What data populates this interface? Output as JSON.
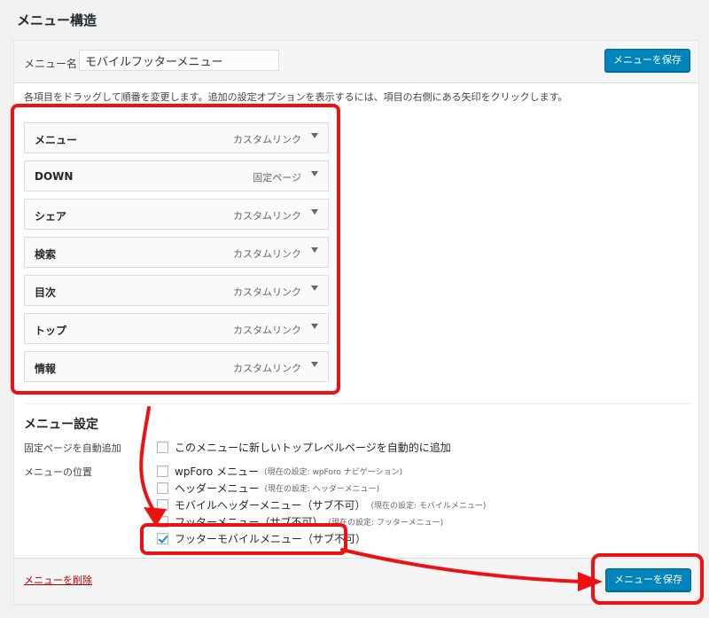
{
  "page_title": "メニュー構造",
  "menu_name": {
    "label": "メニュー名",
    "value": "モバイルフッターメニュー"
  },
  "save_button_label": "メニューを保存",
  "instructions": "各項目をドラッグして順番を変更します。追加の設定オプションを表示するには、項目の右側にある矢印をクリックします。",
  "menu_items": [
    {
      "title": "メニュー",
      "type": "カスタムリンク"
    },
    {
      "title": "DOWN",
      "type": "固定ページ"
    },
    {
      "title": "シェア",
      "type": "カスタムリンク"
    },
    {
      "title": "検索",
      "type": "カスタムリンク"
    },
    {
      "title": "目次",
      "type": "カスタムリンク"
    },
    {
      "title": "トップ",
      "type": "カスタムリンク"
    },
    {
      "title": "情報",
      "type": "カスタムリンク"
    }
  ],
  "settings": {
    "title": "メニュー設定",
    "auto_add": {
      "label": "固定ページを自動追加",
      "option": "このメニューに新しいトップレベルページを自動的に追加",
      "checked": false
    },
    "locations_label": "メニューの位置",
    "locations": [
      {
        "label": "wpForo メニュー",
        "note": "(現在の設定: wpForo ナビゲーション)",
        "checked": false
      },
      {
        "label": "ヘッダーメニュー",
        "note": "(現在の設定: ヘッダーメニュー)",
        "checked": false
      },
      {
        "label": "モバイルヘッダーメニュー（サブ不可）",
        "note": "(現在の設定: モバイルメニュー)",
        "checked": false
      },
      {
        "label": "フッターメニュー（サブ不可）",
        "note": "(現在の設定: フッターメニュー)",
        "checked": false
      },
      {
        "label": "フッターモバイルメニュー（サブ不可）",
        "note": "",
        "checked": true
      }
    ]
  },
  "delete_link": "メニューを削除",
  "colors": {
    "primary_button": "#0085ba",
    "annotation": "#ee1111",
    "delete_link": "#aa0000"
  }
}
